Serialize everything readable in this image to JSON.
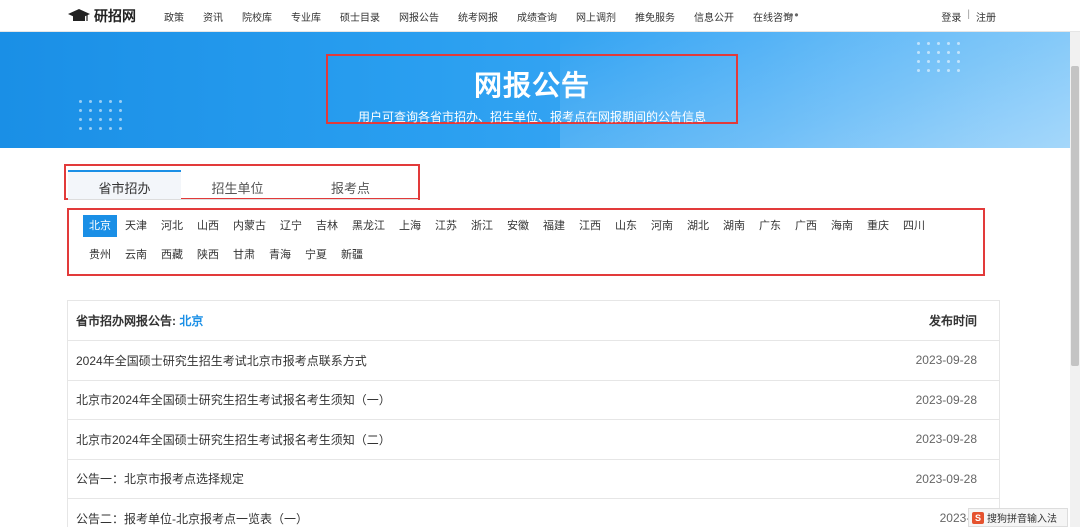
{
  "nav": {
    "logo_text": "研招网",
    "items": [
      "政策",
      "资讯",
      "院校库",
      "专业库",
      "硕士目录",
      "网报公告",
      "统考网报",
      "成绩查询",
      "网上调剂",
      "推免服务",
      "信息公开",
      "在线咨询"
    ],
    "more": "•••",
    "login": "登录",
    "separator": "|",
    "register": "注册"
  },
  "banner": {
    "title": "网报公告",
    "subtitle": "用户可查询各省市招办、招生单位、报考点在网报期间的公告信息"
  },
  "tabs": [
    "省市招办",
    "招生单位",
    "报考点"
  ],
  "provinces_row1": [
    "北京",
    "天津",
    "河北",
    "山西",
    "内蒙古",
    "辽宁",
    "吉林",
    "黑龙江",
    "上海",
    "江苏",
    "浙江",
    "安徽",
    "福建",
    "江西",
    "山东",
    "河南",
    "湖北",
    "湖南",
    "广东",
    "广西",
    "海南",
    "重庆",
    "四川"
  ],
  "provinces_row2": [
    "贵州",
    "云南",
    "西藏",
    "陕西",
    "甘肃",
    "青海",
    "宁夏",
    "新疆"
  ],
  "list": {
    "head_label": "省市招办网报公告:",
    "head_city": "北京",
    "head_date": "发布时间",
    "rows": [
      {
        "title": "2024年全国硕士研究生招生考试北京市报考点联系方式",
        "date": "2023-09-28"
      },
      {
        "title": "北京市2024年全国硕士研究生招生考试报名考生须知（一）",
        "date": "2023-09-28"
      },
      {
        "title": "北京市2024年全国硕士研究生招生考试报名考生须知（二）",
        "date": "2023-09-28"
      },
      {
        "title": "公告一：北京市报考点选择规定",
        "date": "2023-09-28"
      },
      {
        "title": "公告二：报考单位-北京报考点一览表（一）",
        "date": "2023-0"
      }
    ]
  },
  "ime": {
    "logo": "S",
    "label": "搜狗拼音输入法"
  },
  "colors": {
    "accent": "#1a8fe6",
    "highlight_border": "#e23a3a"
  }
}
